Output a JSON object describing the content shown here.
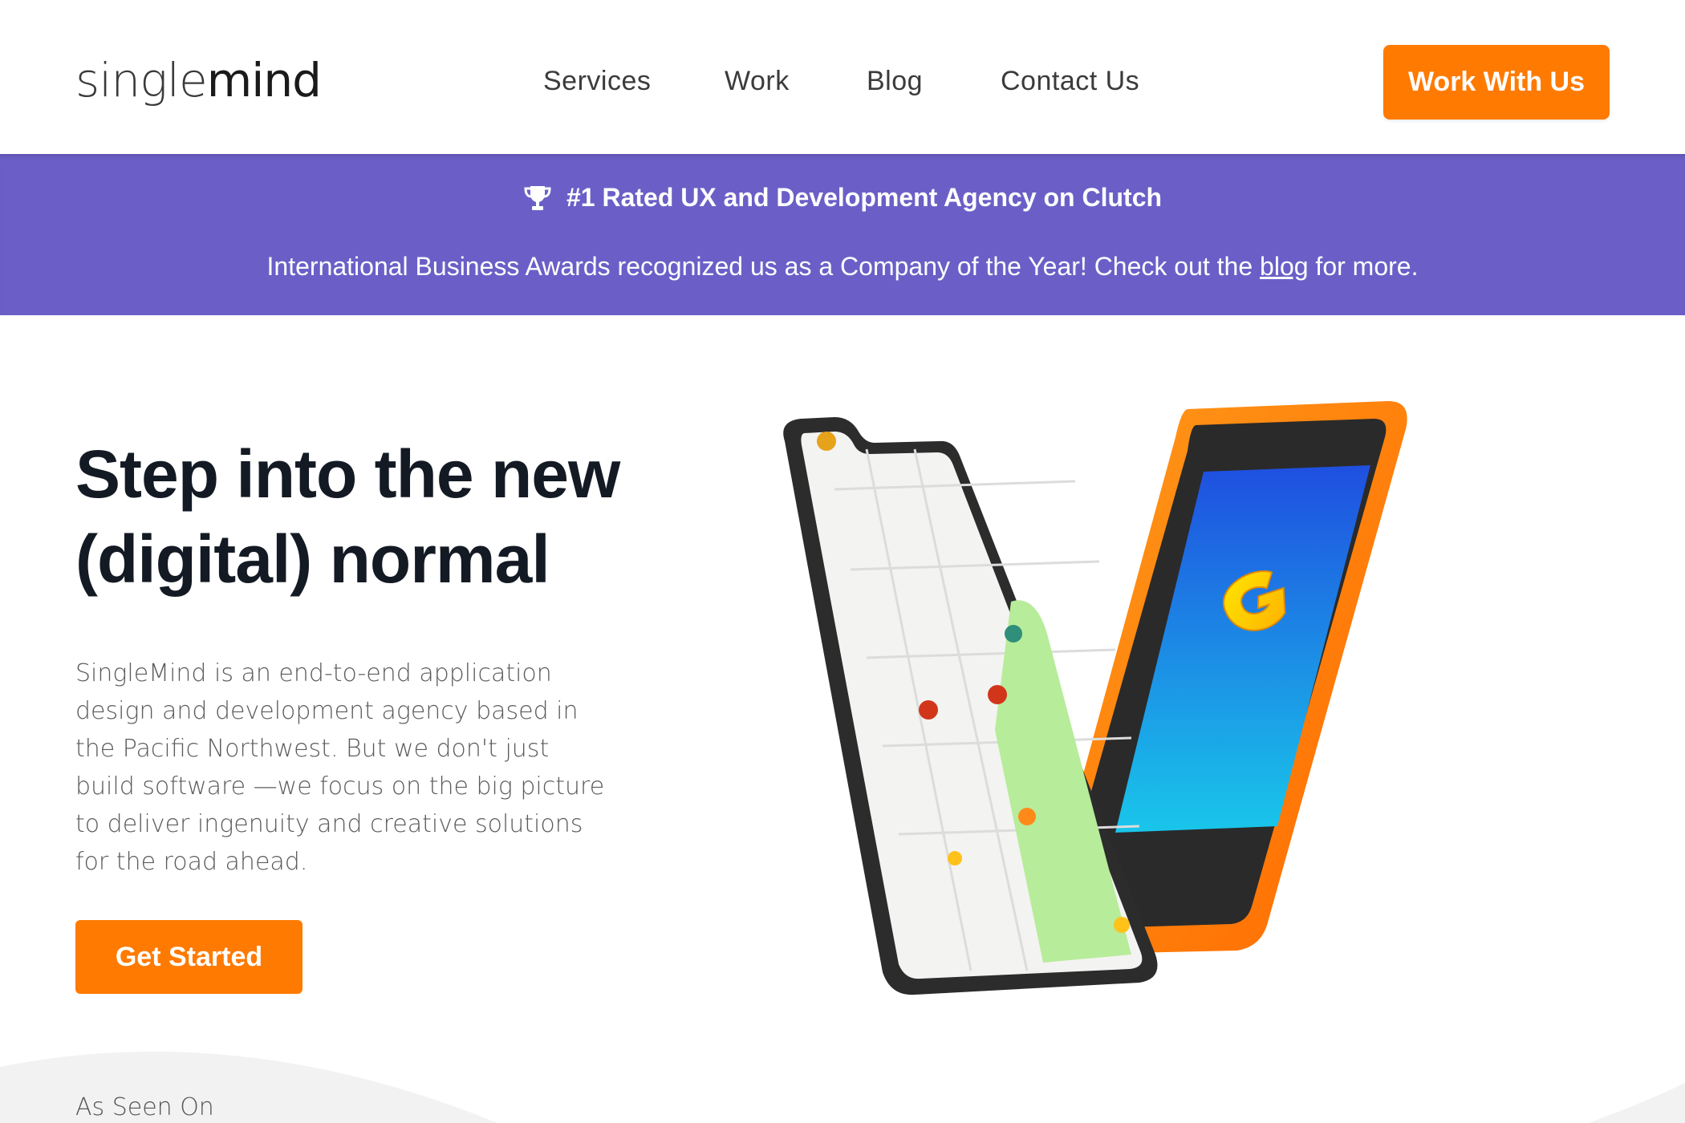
{
  "header": {
    "logo": {
      "part1": "single",
      "part2": "mind"
    },
    "nav": [
      {
        "label": "Services"
      },
      {
        "label": "Work"
      },
      {
        "label": "Blog"
      },
      {
        "label": "Contact Us"
      }
    ],
    "cta_label": "Work With Us"
  },
  "banner": {
    "headline": "#1 Rated UX and Development Agency on Clutch",
    "text_before_link": "International Business Awards recognized us as a Company of the Year! Check out the ",
    "link_label": "blog",
    "text_after_link": " for more.",
    "icon": "trophy-icon"
  },
  "hero": {
    "title_line1": "Step into the new",
    "title_line2": "(digital) normal",
    "description": "SingleMind is an end-to-end application design and development agency based in the Pacific Northwest. But we don't just build software —we focus on the big picture to deliver ingenuity and creative solutions for the road ahead.",
    "cta_label": "Get Started"
  },
  "as_seen_on": "As Seen On",
  "colors": {
    "accent": "#ff7a00",
    "banner": "#6b5fc7",
    "heading": "#141a24"
  }
}
